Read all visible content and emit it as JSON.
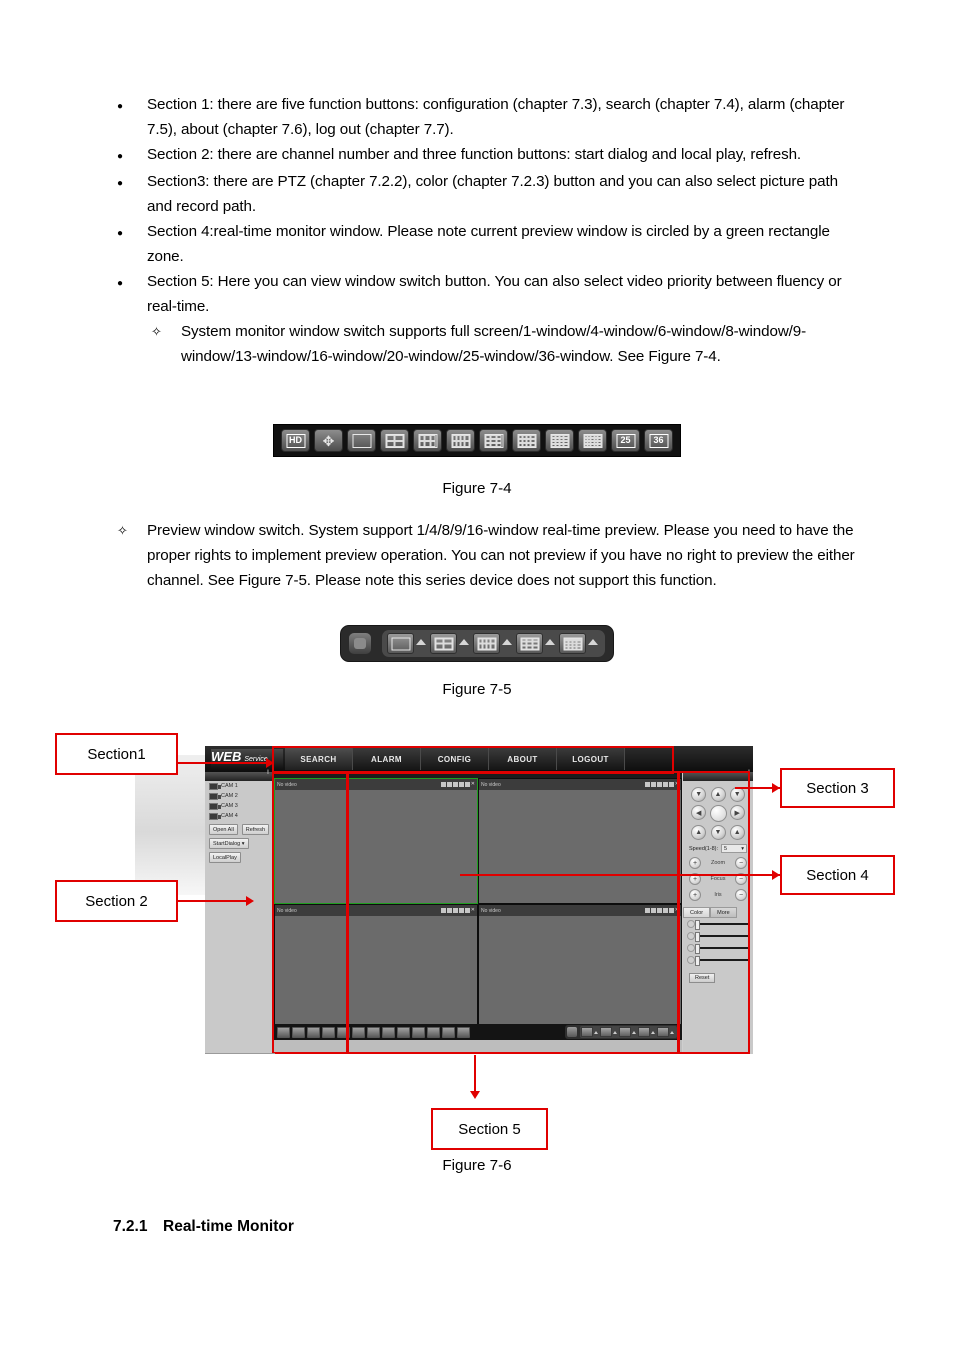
{
  "body_text": {
    "bullets": [
      "Section 1: there are five function buttons: configuration (chapter 7.3), search (chapter 7.4), alarm (chapter 7.5), about (chapter 7.6), log out (chapter 7.7).",
      "Section 2: there are channel number and three function buttons: start dialog and local play, refresh.",
      "Section3: there are PTZ (chapter 7.2.2), color (chapter 7.2.3) button and you can also select picture path and record path.",
      "Section 4:real-time monitor window. Please note current preview window is circled by a green rectangle zone.",
      "Section 5: Here you can view window switch button.  You can also select video priority between fluency or real-time."
    ],
    "sub_bullet_1": "System monitor window switch supports full screen/1-window/4-window/6-window/8-window/9-window/13-window/16-window/20-window/25-window/36-window. See Figure 7-4.",
    "sub_bullet_2": "Preview window switch. System support 1/4/8/9/16-window real-time preview. Please you need to have the proper rights to implement preview operation. You can not preview if you have no right to preview the either channel. See Figure 7-5. Please note this series device does not support this function."
  },
  "captions": {
    "fig74": "Figure 7-4",
    "fig75": "Figure 7-5",
    "fig76": "Figure 7-6"
  },
  "figure_74": {
    "buttons": [
      {
        "name": "hd-button",
        "label": "HD",
        "kind": "text"
      },
      {
        "name": "fullscreen-button",
        "label": "✥",
        "kind": "fs"
      },
      {
        "name": "window-1-button",
        "label": "1-window",
        "kind": "grid",
        "cols": 1,
        "rows": 1
      },
      {
        "name": "window-4-button",
        "label": "4-window",
        "kind": "grid",
        "cols": 2,
        "rows": 2
      },
      {
        "name": "window-6-button",
        "label": "6-window",
        "kind": "grid",
        "cols": 3,
        "rows": 2
      },
      {
        "name": "window-8-button",
        "label": "8-window",
        "kind": "grid",
        "cols": 4,
        "rows": 2
      },
      {
        "name": "window-9-button",
        "label": "9-window",
        "kind": "grid",
        "cols": 3,
        "rows": 3
      },
      {
        "name": "window-13-button",
        "label": "13-window",
        "kind": "grid",
        "cols": 4,
        "rows": 3
      },
      {
        "name": "window-16-button",
        "label": "16-window",
        "kind": "grid",
        "cols": 4,
        "rows": 4
      },
      {
        "name": "window-20-button",
        "label": "20-window",
        "kind": "grid",
        "cols": 5,
        "rows": 4
      },
      {
        "name": "window-25-button",
        "label": "25",
        "kind": "text"
      },
      {
        "name": "window-36-button",
        "label": "36",
        "kind": "text"
      }
    ]
  },
  "figure_75": {
    "knob_name": "preview-switch-knob",
    "buttons": [
      {
        "name": "preview-1-window-button",
        "cols": 1,
        "rows": 1
      },
      {
        "name": "preview-4-window-button",
        "cols": 2,
        "rows": 2
      },
      {
        "name": "preview-8-window-button",
        "cols": 4,
        "rows": 2
      },
      {
        "name": "preview-9-window-button",
        "cols": 3,
        "rows": 3
      },
      {
        "name": "preview-16-window-button",
        "cols": 4,
        "rows": 4
      }
    ]
  },
  "figure_76": {
    "annotations": [
      {
        "name": "section1-label",
        "label": "Section1"
      },
      {
        "name": "section2-label",
        "label": "Section 2"
      },
      {
        "name": "section3-label",
        "label": "Section 3"
      },
      {
        "name": "section4-label",
        "label": "Section 4"
      },
      {
        "name": "section5-label",
        "label": "Section 5"
      }
    ],
    "logo": {
      "web": "WEB",
      "service": "Service"
    },
    "nav": [
      "SEARCH",
      "ALARM",
      "CONFIG",
      "ABOUT",
      "LOGOUT"
    ],
    "channel_panel": {
      "cameras": [
        "CAM 1",
        "CAM 2",
        "CAM 3",
        "CAM 4"
      ],
      "buttons": [
        "Open All",
        "Refresh",
        "StartDialog",
        "LocalPlay"
      ]
    },
    "monitor": {
      "cells": [
        {
          "title": "No video",
          "selected": true
        },
        {
          "title": "No video",
          "selected": false
        },
        {
          "title": "No video",
          "selected": false
        },
        {
          "title": "No video",
          "selected": false
        }
      ],
      "selection_color": "#1f9e1f"
    },
    "ptz": {
      "speed_label": "Speed(1-8):",
      "speed_value": "5",
      "controls": [
        "Zoom",
        "Focus",
        "Iris"
      ],
      "plus": "+",
      "minus": "−",
      "tabs": [
        "Color",
        "More"
      ],
      "reset_label": "Reset"
    }
  },
  "heading": {
    "number": "7.2.1",
    "title": "Real-time Monitor"
  },
  "colors": {
    "annotation_red": "#e00000",
    "selection_green": "#1f9e1f"
  }
}
